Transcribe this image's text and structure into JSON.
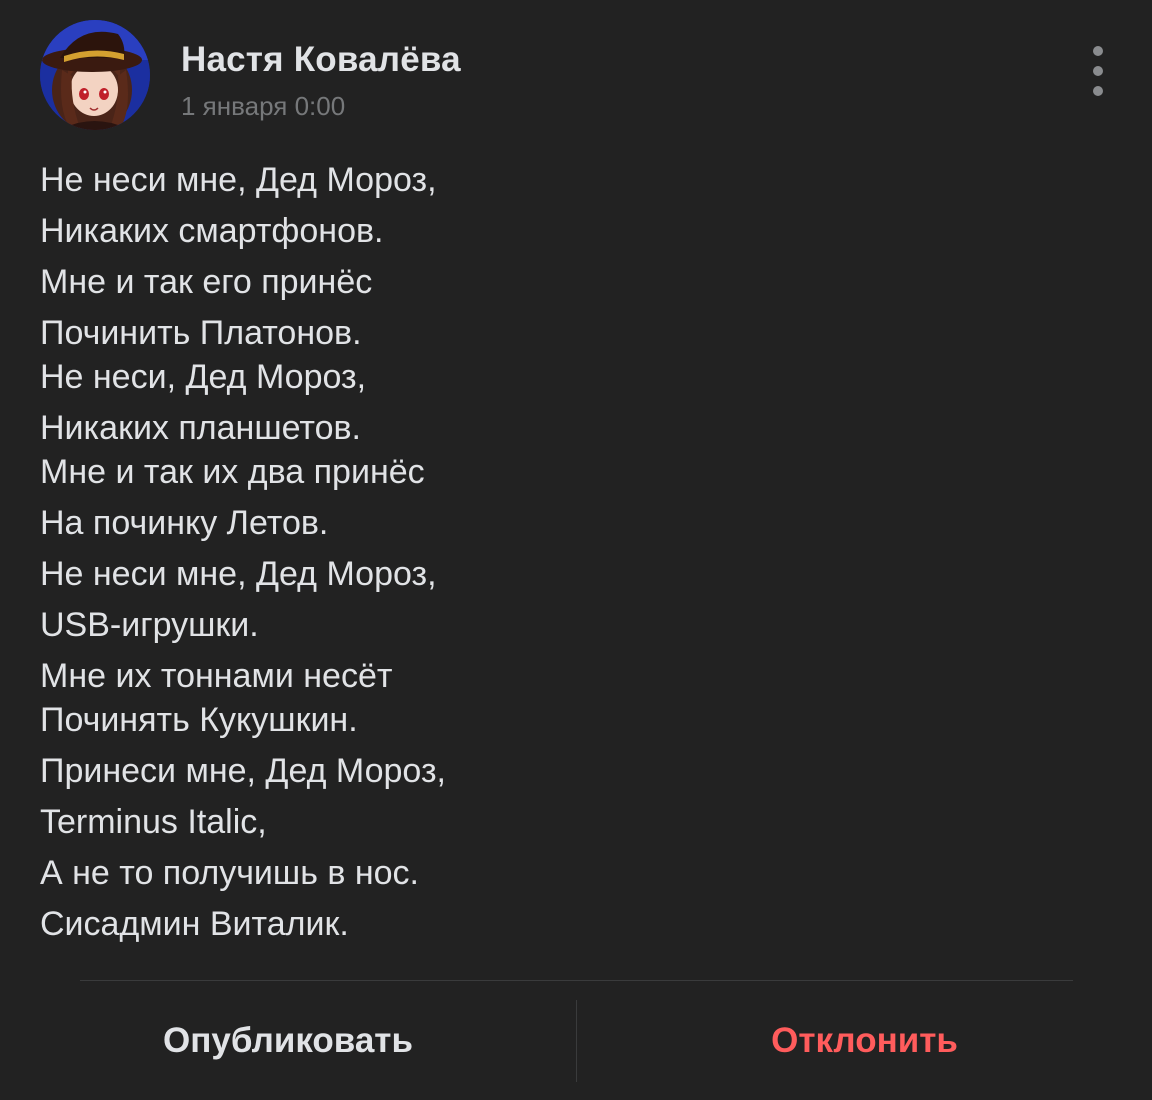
{
  "post": {
    "author": {
      "name": "Настя Ковалёва",
      "avatar": "avatar-anime-girl-witch-hat"
    },
    "date": "1 января 0:00",
    "menu_icon": "more-vertical-icon",
    "lines": [
      "Не неси мне, Дед Мороз,",
      "Никаких смартфонов.",
      "Мне и так его принёс",
      "Починить Платонов.",
      "Не неси, Дед Мороз,",
      "Никаких планшетов.",
      "Мне и так их два принёс",
      "На починку Летов.",
      "Не неси мне, Дед Мороз,",
      "USB-игрушки.",
      "Мне их тоннами несёт",
      "Починять Кукушкин.",
      "Принеси мне, Дед Мороз,",
      "Terminus Italic,",
      "А не то получишь в нос.",
      "Сисадмин Виталик."
    ]
  },
  "actions": {
    "publish_label": "Опубликовать",
    "reject_label": "Отклонить"
  },
  "colors": {
    "background": "#222222",
    "text": "#e1e3e6",
    "secondary_text": "#76787a",
    "reject": "#ff5c5c",
    "divider": "#3a3b3c"
  }
}
